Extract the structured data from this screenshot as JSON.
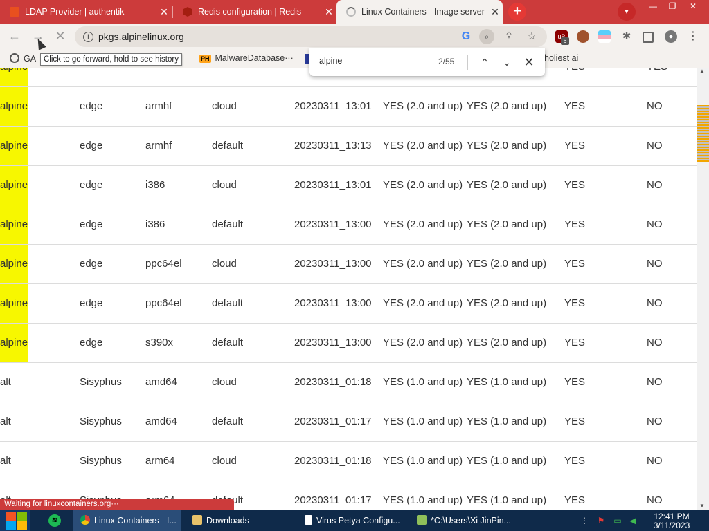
{
  "tabs": [
    {
      "title": "LDAP Provider | authentik",
      "close": "✕"
    },
    {
      "title": "Redis configuration | Redis",
      "close": "✕"
    },
    {
      "title": "Linux Containers - Image server",
      "close": "✕"
    }
  ],
  "new_tab_glyph": "+",
  "tab_search_glyph": "▾",
  "window_controls": {
    "minimize": "—",
    "maximize": "❐",
    "close": "✕"
  },
  "toolbar": {
    "back": "←",
    "forward": "→",
    "reload": "✕",
    "url": "pkgs.alpinelinux.org",
    "google_glyph": "G",
    "find_glyph": "⌕",
    "share_glyph": "⇪",
    "star_glyph": "☆"
  },
  "extensions": {
    "ublock": "uB",
    "ublock_badge": "6",
    "puzzle": "✱",
    "menu": "⋮",
    "profile": "●"
  },
  "bookmarks": {
    "ga": "GA",
    "malware": "MalwareDatabase···",
    "ph_badge": "PH",
    "holy": "holiest ai"
  },
  "tooltip": "Click to go forward, hold to see history",
  "findbar": {
    "query": "alpine",
    "count": "2/55",
    "prev": "⌃",
    "next": "⌄",
    "close": "✕"
  },
  "table_rows": [
    {
      "os": "alpine",
      "release": "edge",
      "arch": "armhf",
      "variant": "cloud",
      "build": "20230311_13:01",
      "c5": "YES (2.0 and up)",
      "c6": "YES (2.0 and up)",
      "c7": "YES",
      "c8": "NO",
      "hl": true
    },
    {
      "os": "alpine",
      "release": "edge",
      "arch": "armhf",
      "variant": "default",
      "build": "20230311_13:13",
      "c5": "YES (2.0 and up)",
      "c6": "YES (2.0 and up)",
      "c7": "YES",
      "c8": "NO",
      "hl": true
    },
    {
      "os": "alpine",
      "release": "edge",
      "arch": "i386",
      "variant": "cloud",
      "build": "20230311_13:01",
      "c5": "YES (2.0 and up)",
      "c6": "YES (2.0 and up)",
      "c7": "YES",
      "c8": "NO",
      "hl": true
    },
    {
      "os": "alpine",
      "release": "edge",
      "arch": "i386",
      "variant": "default",
      "build": "20230311_13:00",
      "c5": "YES (2.0 and up)",
      "c6": "YES (2.0 and up)",
      "c7": "YES",
      "c8": "NO",
      "hl": true
    },
    {
      "os": "alpine",
      "release": "edge",
      "arch": "ppc64el",
      "variant": "cloud",
      "build": "20230311_13:00",
      "c5": "YES (2.0 and up)",
      "c6": "YES (2.0 and up)",
      "c7": "YES",
      "c8": "NO",
      "hl": true
    },
    {
      "os": "alpine",
      "release": "edge",
      "arch": "ppc64el",
      "variant": "default",
      "build": "20230311_13:00",
      "c5": "YES (2.0 and up)",
      "c6": "YES (2.0 and up)",
      "c7": "YES",
      "c8": "NO",
      "hl": true
    },
    {
      "os": "alpine",
      "release": "edge",
      "arch": "s390x",
      "variant": "default",
      "build": "20230311_13:00",
      "c5": "YES (2.0 and up)",
      "c6": "YES (2.0 and up)",
      "c7": "YES",
      "c8": "NO",
      "hl": true
    },
    {
      "os": "alt",
      "release": "Sisyphus",
      "arch": "amd64",
      "variant": "cloud",
      "build": "20230311_01:18",
      "c5": "YES (1.0 and up)",
      "c6": "YES (1.0 and up)",
      "c7": "YES",
      "c8": "NO",
      "hl": false
    },
    {
      "os": "alt",
      "release": "Sisyphus",
      "arch": "amd64",
      "variant": "default",
      "build": "20230311_01:17",
      "c5": "YES (1.0 and up)",
      "c6": "YES (1.0 and up)",
      "c7": "YES",
      "c8": "NO",
      "hl": false
    },
    {
      "os": "alt",
      "release": "Sisyphus",
      "arch": "arm64",
      "variant": "cloud",
      "build": "20230311_01:18",
      "c5": "YES (1.0 and up)",
      "c6": "YES (1.0 and up)",
      "c7": "YES",
      "c8": "NO",
      "hl": false
    },
    {
      "os": "alt",
      "release": "Sisyphus",
      "arch": "arm64",
      "variant": "default",
      "build": "20230311_01:17",
      "c5": "YES (1.0 and up)",
      "c6": "YES (1.0 and up)",
      "c7": "YES",
      "c8": "NO",
      "hl": false
    }
  ],
  "partial_top_row": {
    "os": "alpine",
    "c7": "YES",
    "c8": "YES"
  },
  "status": "Waiting for linuxcontainers.org···",
  "taskbar": {
    "chrome": "Linux Containers - I...",
    "downloads": "Downloads",
    "virus": "Virus Petya Configu...",
    "notepad": "*C:\\Users\\Xi JinPin...",
    "time": "12:41 PM",
    "date": "3/11/2023"
  },
  "tray": {
    "more": "⋮",
    "flag": "⚑",
    "network": "▭",
    "volume": "◀"
  },
  "colors": {
    "tab_strip": "#cc3b3b",
    "highlight": "#f7f700",
    "taskbar": "#0f2a4a"
  }
}
